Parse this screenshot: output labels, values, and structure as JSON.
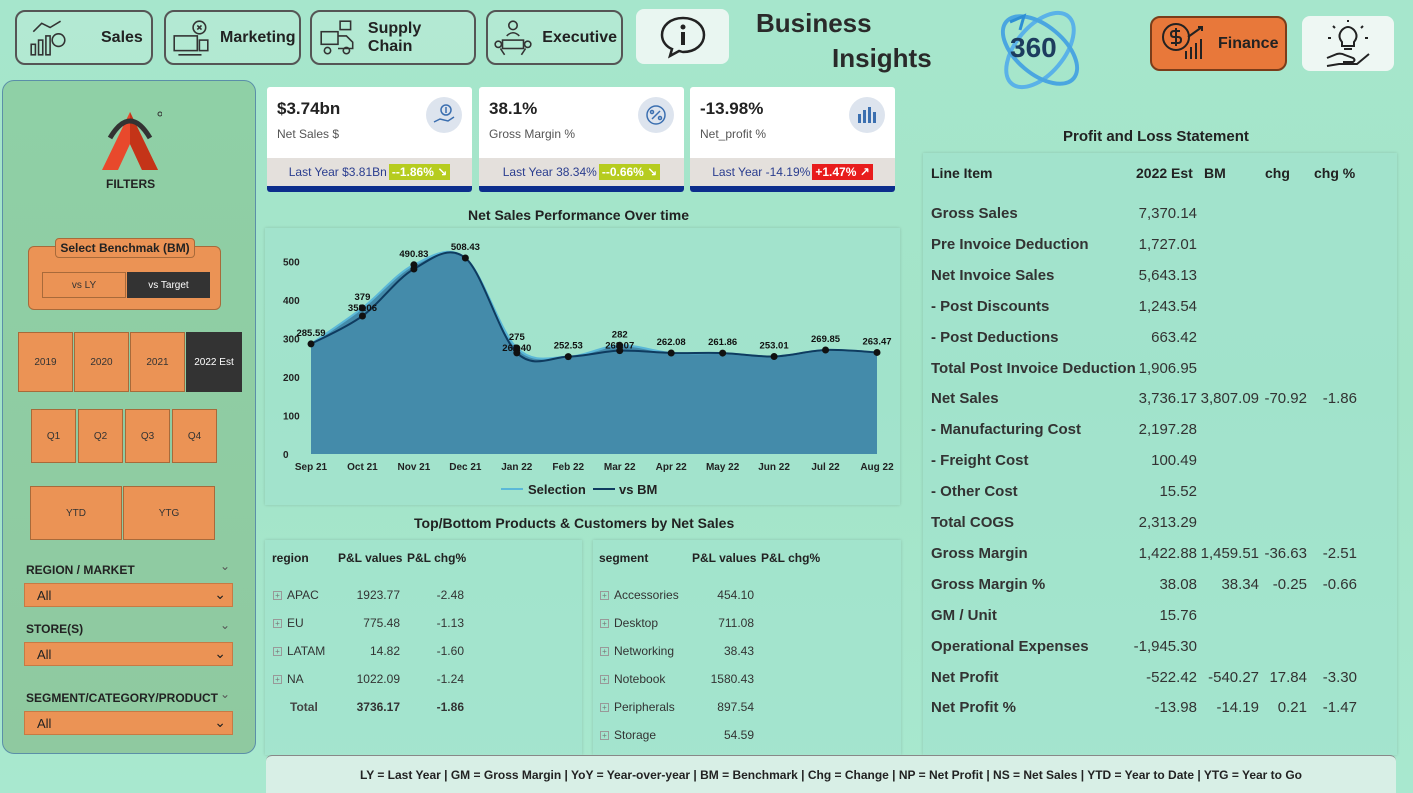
{
  "nav": {
    "sales": "Sales",
    "marketing": "Marketing",
    "supply_chain": "Supply Chain",
    "executive": "Executive",
    "finance": "Finance"
  },
  "header": {
    "title_line1": "Business",
    "title_line2": "Insights",
    "logo_text": "360"
  },
  "filters": {
    "logo_label": "FILTERS",
    "benchmark_title": "Select Benchmak (BM)",
    "benchmark_options": [
      "vs LY",
      "vs Target"
    ],
    "benchmark_selected": "vs Target",
    "years": [
      "2019",
      "2020",
      "2021",
      "2022 Est"
    ],
    "year_selected": "2022 Est",
    "quarters": [
      "Q1",
      "Q2",
      "Q3",
      "Q4"
    ],
    "period": [
      "YTD",
      "YTG"
    ],
    "region_label": "REGION / MARKET",
    "region_value": "All",
    "store_label": "STORE(S)",
    "store_value": "All",
    "segment_label": "SEGMENT/CATEGORY/PRODUCT",
    "segment_value": "All"
  },
  "kpis": [
    {
      "value": "$3.74bn",
      "label": "Net Sales $",
      "last_year": "Last Year $3.81Bn",
      "chg": "--1.86% ↘",
      "chg_color": "#b6cc1f"
    },
    {
      "value": "38.1%",
      "label": "Gross Margin %",
      "last_year": "Last Year 38.34%",
      "chg": "--0.66% ↘",
      "chg_color": "#b6cc1f"
    },
    {
      "value": "-13.98%",
      "label": "Net_profit %",
      "last_year": "Last Year -14.19%",
      "chg": "+1.47% ↗",
      "chg_color": "#e81c1c"
    }
  ],
  "chart_title": "Net Sales Performance Over time",
  "chart_data": {
    "type": "area",
    "categories": [
      "Sep 21",
      "Oct 21",
      "Nov 21",
      "Dec 21",
      "Jan 22",
      "Feb 22",
      "Mar 22",
      "Apr 22",
      "May 22",
      "Jun 22",
      "Jul 22",
      "Aug 22"
    ],
    "series": [
      {
        "name": "Selection",
        "values": [
          285.59,
          379,
          490.83,
          508.43,
          275,
          252.53,
          282,
          262.08,
          261.86,
          253.01,
          269.85,
          263.47
        ]
      },
      {
        "name": "vs BM",
        "values": [
          285.59,
          358.06,
          480,
          508.43,
          262.4,
          252.53,
          268.07,
          262.08,
          261.86,
          253.01,
          269.85,
          263.47
        ]
      }
    ],
    "data_labels": [
      {
        "i": 0,
        "text": "285.59"
      },
      {
        "i": 1,
        "text": "379"
      },
      {
        "i": 1,
        "text": "358.06"
      },
      {
        "i": 2,
        "text": "490.83"
      },
      {
        "i": 3,
        "text": "508.43"
      },
      {
        "i": 4,
        "text": "275"
      },
      {
        "i": 4,
        "text": "262.40"
      },
      {
        "i": 5,
        "text": "252.53"
      },
      {
        "i": 6,
        "text": "282"
      },
      {
        "i": 6,
        "text": "268.07"
      },
      {
        "i": 7,
        "text": "262.08"
      },
      {
        "i": 8,
        "text": "261.86"
      },
      {
        "i": 9,
        "text": "253.01"
      },
      {
        "i": 10,
        "text": "269.85"
      },
      {
        "i": 11,
        "text": "263.47"
      }
    ],
    "yticks": [
      "0",
      "100",
      "200",
      "300",
      "400",
      "500"
    ],
    "ylim": [
      0,
      550
    ],
    "colors": {
      "selection": "#5bb8d8",
      "bm": "#0f3b5f",
      "area": "#3f86a8"
    },
    "legend_position": "bottom"
  },
  "tables_title": "Top/Bottom Products & Customers by Net Sales",
  "region_table": {
    "headers": [
      "region",
      "P&L values",
      "P&L chg%"
    ],
    "rows": [
      [
        "APAC",
        "1923.77",
        "-2.48"
      ],
      [
        "EU",
        "775.48",
        "-1.13"
      ],
      [
        "LATAM",
        "14.82",
        "-1.60"
      ],
      [
        "NA",
        "1022.09",
        "-1.24"
      ]
    ],
    "total": [
      "Total",
      "3736.17",
      "-1.86"
    ]
  },
  "segment_table": {
    "headers": [
      "segment",
      "P&L values",
      "P&L chg%"
    ],
    "rows": [
      [
        "Accessories",
        "454.10"
      ],
      [
        "Desktop",
        "711.08"
      ],
      [
        "Networking",
        "38.43"
      ],
      [
        "Notebook",
        "1580.43"
      ],
      [
        "Peripherals",
        "897.54"
      ],
      [
        "Storage",
        "54.59"
      ]
    ]
  },
  "pl": {
    "title": "Profit and Loss Statement",
    "headers": [
      "Line Item",
      "2022 Est",
      "BM",
      "chg",
      "chg %"
    ],
    "rows": [
      [
        "Gross Sales",
        "7,370.14",
        "",
        "",
        ""
      ],
      [
        "Pre Invoice Deduction",
        "1,727.01",
        "",
        "",
        ""
      ],
      [
        "Net Invoice Sales",
        "5,643.13",
        "",
        "",
        ""
      ],
      [
        "- Post Discounts",
        "1,243.54",
        "",
        "",
        ""
      ],
      [
        "- Post Deductions",
        "663.42",
        "",
        "",
        ""
      ],
      [
        "Total Post Invoice Deduction",
        "1,906.95",
        "",
        "",
        ""
      ],
      [
        "Net Sales",
        "3,736.17",
        "3,807.09",
        "-70.92",
        "-1.86"
      ],
      [
        "- Manufacturing Cost",
        "2,197.28",
        "",
        "",
        ""
      ],
      [
        "- Freight Cost",
        "100.49",
        "",
        "",
        ""
      ],
      [
        "- Other Cost",
        "15.52",
        "",
        "",
        ""
      ],
      [
        "Total COGS",
        "2,313.29",
        "",
        "",
        ""
      ],
      [
        "Gross Margin",
        "1,422.88",
        "1,459.51",
        "-36.63",
        "-2.51"
      ],
      [
        "Gross Margin %",
        "38.08",
        "38.34",
        "-0.25",
        "-0.66"
      ],
      [
        "GM / Unit",
        "15.76",
        "",
        "",
        ""
      ],
      [
        "Operational Expenses",
        "-1,945.30",
        "",
        "",
        ""
      ],
      [
        "Net Profit",
        "-522.42",
        "-540.27",
        "17.84",
        "-3.30"
      ],
      [
        "Net Profit %",
        "-13.98",
        "-14.19",
        "0.21",
        "-1.47"
      ]
    ]
  },
  "footer": "LY = Last Year | GM = Gross Margin | YoY = Year-over-year | BM = Benchmark | Chg = Change | NP = Net Profit | NS = Net Sales | YTD = Year to Date | YTG = Year to Go"
}
